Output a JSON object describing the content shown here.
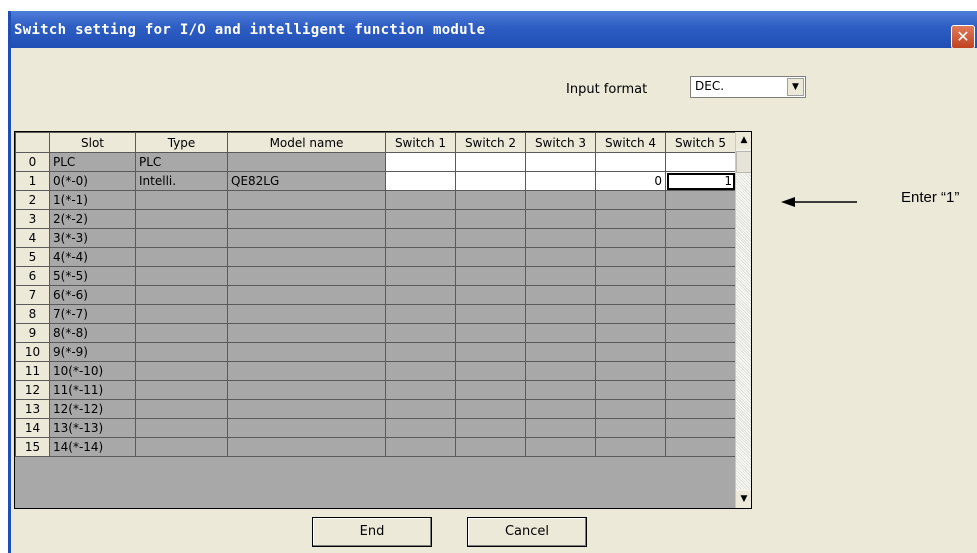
{
  "window": {
    "title": "Switch setting for I/O and intelligent function module",
    "close_label": "✕"
  },
  "input_format": {
    "label": "Input format",
    "value": "DEC.",
    "arrow": "▼"
  },
  "table": {
    "headers": [
      "Slot",
      "Type",
      "Model name",
      "Switch 1",
      "Switch 2",
      "Switch 3",
      "Switch 4",
      "Switch 5"
    ],
    "rows": [
      {
        "num": "0",
        "slot": "PLC",
        "type": "PLC",
        "model": "",
        "s1": "",
        "s2": "",
        "s3": "",
        "s4": "",
        "s5": ""
      },
      {
        "num": "1",
        "slot": "0(*-0)",
        "type": "Intelli.",
        "model": "QE82LG",
        "s1": "",
        "s2": "",
        "s3": "",
        "s4": "0",
        "s5": "1"
      },
      {
        "num": "2",
        "slot": "1(*-1)"
      },
      {
        "num": "3",
        "slot": "2(*-2)"
      },
      {
        "num": "4",
        "slot": "3(*-3)"
      },
      {
        "num": "5",
        "slot": "4(*-4)"
      },
      {
        "num": "6",
        "slot": "5(*-5)"
      },
      {
        "num": "7",
        "slot": "6(*-6)"
      },
      {
        "num": "8",
        "slot": "7(*-7)"
      },
      {
        "num": "9",
        "slot": "8(*-8)"
      },
      {
        "num": "10",
        "slot": "9(*-9)"
      },
      {
        "num": "11",
        "slot": "10(*-10)"
      },
      {
        "num": "12",
        "slot": "11(*-11)"
      },
      {
        "num": "13",
        "slot": "12(*-12)"
      },
      {
        "num": "14",
        "slot": "13(*-13)"
      },
      {
        "num": "15",
        "slot": "14(*-14)"
      }
    ]
  },
  "scrollbar": {
    "up": "▲",
    "down": "▼"
  },
  "buttons": {
    "end": "End",
    "cancel": "Cancel"
  },
  "annotation": {
    "text": "Enter “1”"
  }
}
